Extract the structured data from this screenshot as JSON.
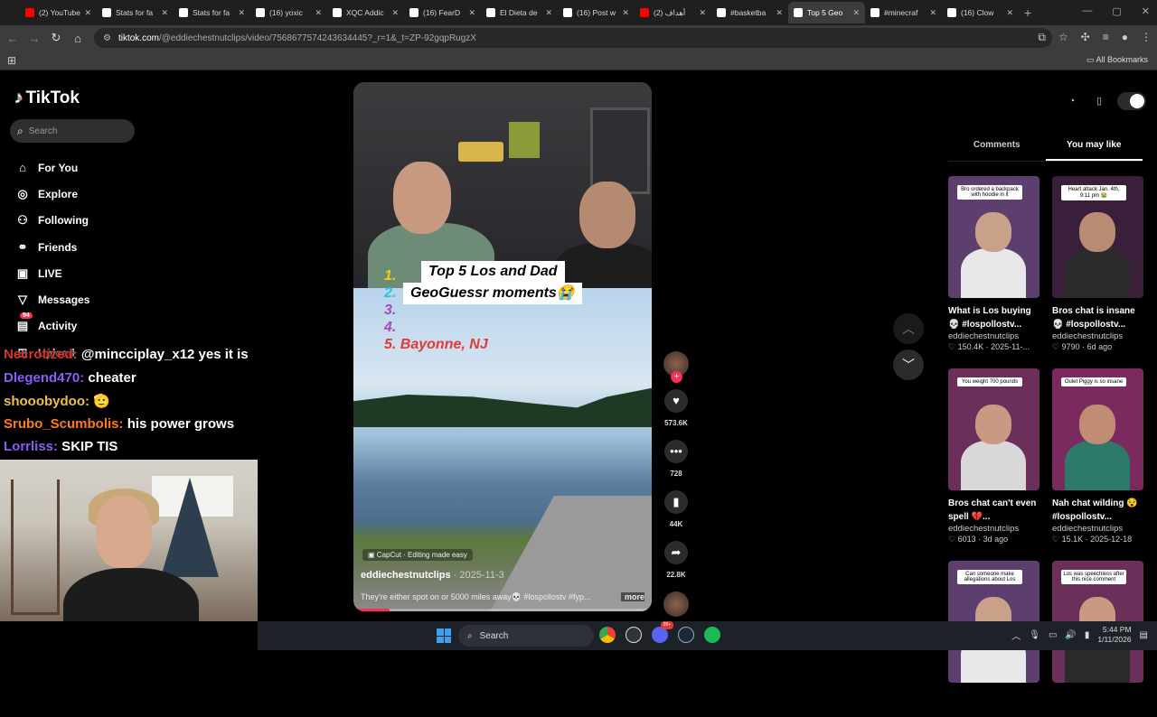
{
  "browser": {
    "tabs": [
      {
        "title": "(2) YouTube",
        "fav": "#ff0000",
        "active": false
      },
      {
        "title": "Stats for fa",
        "fav": "#ffffff",
        "active": false
      },
      {
        "title": "Stats for fa",
        "fav": "#ffffff",
        "active": false
      },
      {
        "title": "(16) yoxic",
        "fav": "#ffffff",
        "active": false
      },
      {
        "title": "XQC Addic",
        "fav": "#ffffff",
        "active": false
      },
      {
        "title": "(16) FearD",
        "fav": "#ffffff",
        "active": false
      },
      {
        "title": "El Dieta de",
        "fav": "#ffffff",
        "active": false
      },
      {
        "title": "(16) Post w",
        "fav": "#ffffff",
        "active": false
      },
      {
        "title": "(2) أهداف",
        "fav": "#ff0000",
        "active": false
      },
      {
        "title": "#basketba",
        "fav": "#ffffff",
        "active": false
      },
      {
        "title": "Top 5 Geo",
        "fav": "#ffffff",
        "active": true
      },
      {
        "title": "#minecraf",
        "fav": "#ffffff",
        "active": false
      },
      {
        "title": "(16) Clow",
        "fav": "#ffffff",
        "active": false
      }
    ],
    "url_host": "tiktok.com",
    "url_path": "/@eddiechestnutclips/video/7568677574243634445?_r=1&_t=ZP-92gqpRugzX",
    "all_bookmarks": "All Bookmarks"
  },
  "sidebar": {
    "logo": "TikTok",
    "search_placeholder": "Search",
    "items": [
      {
        "label": "For You",
        "icon": "home-icon",
        "glyph": "⌂"
      },
      {
        "label": "Explore",
        "icon": "compass-icon",
        "glyph": "◎"
      },
      {
        "label": "Following",
        "icon": "following-icon",
        "glyph": "⚇"
      },
      {
        "label": "Friends",
        "icon": "friends-icon",
        "glyph": "⚭"
      },
      {
        "label": "LIVE",
        "icon": "live-icon",
        "glyph": "▣"
      },
      {
        "label": "Messages",
        "icon": "messages-icon",
        "glyph": "▽"
      },
      {
        "label": "Activity",
        "icon": "activity-icon",
        "glyph": "▤",
        "badge": "94"
      },
      {
        "label": "Upload",
        "icon": "upload-icon",
        "glyph": "⊞"
      }
    ]
  },
  "chat": [
    {
      "user": "Necrotized:",
      "color": "#e0302a",
      "msg": " @mincciplay_x12 yes it is"
    },
    {
      "user": "Dlegend470:",
      "color": "#8a5cf6",
      "msg": " cheater"
    },
    {
      "user": "shooobydoo:",
      "color": "#f0c040",
      "msg": " 🫡"
    },
    {
      "user": "Srubo_Scumbolis:",
      "color": "#ff7a1a",
      "msg": " his power grows"
    },
    {
      "user": "Lorrliss:",
      "color": "#8a5cf6",
      "msg": " SKIP TIS"
    }
  ],
  "video": {
    "title_line1": "Top 5 Los and Dad",
    "title_line2": "GeoGuessr moments😭",
    "list": [
      {
        "n": "1.",
        "text": "",
        "color": "#f0d000"
      },
      {
        "n": "2.",
        "text": "",
        "color": "#26c6da"
      },
      {
        "n": "3.",
        "text": "",
        "color": "#ab47bc"
      },
      {
        "n": "4.",
        "text": "",
        "color": "#ab47bc"
      },
      {
        "n": "5.",
        "text": "Bayonne, NJ",
        "color": "#e53935"
      }
    ],
    "capcut": "CapCut · Editing made easy",
    "author": "eddiechestnutclips",
    "date": " · 2025-11-3",
    "caption": "They're either spot on or 5000 miles away💀 #lospollostv #fyp...",
    "more": "more",
    "progress": 0.12
  },
  "actions": [
    {
      "icon": "heart-icon",
      "glyph": "♥",
      "count": "573.6K"
    },
    {
      "icon": "comment-icon",
      "glyph": "•••",
      "count": "728"
    },
    {
      "icon": "bookmark-icon",
      "glyph": "▮",
      "count": "44K"
    },
    {
      "icon": "share-icon",
      "glyph": "➦",
      "count": "22.8K"
    }
  ],
  "right_panel": {
    "tabs": [
      "Comments",
      "You may like"
    ],
    "cards": [
      {
        "caption": "Bro ordered a backpack with hoodie in it",
        "title": "What is Los buying 💀 #lospollostv...",
        "author": "eddiechestnutclips",
        "stats": "♡ 150.4K · 2025-11-...",
        "bg": "#5c3f6e",
        "skin": "#c9a08a",
        "shirt": "#e8e8e8"
      },
      {
        "caption": "Heart attack Jan. 4th, 9:11 pm 😭",
        "title": "Bros chat is insane 💀 #lospollostv...",
        "author": "eddiechestnutclips",
        "stats": "♡ 9790 · 6d ago",
        "bg": "#3a1f3a",
        "skin": "#b88c74",
        "shirt": "#2a2a2a"
      },
      {
        "caption": "You weight 700 pounds",
        "title": "Bros chat can't even spell 💔...",
        "author": "eddiechestnutclips",
        "stats": "♡ 6013 · 3d ago",
        "bg": "#6b2f5a",
        "skin": "#c89a84",
        "shirt": "#d8d8d8"
      },
      {
        "caption": "Oulet Piggy is so insane",
        "title": "Nah chat wilding 😵 #lospollostv...",
        "author": "eddiechestnutclips",
        "stats": "♡ 15.1K · 2025-12-18",
        "bg": "#7a2a5e",
        "skin": "#c08c74",
        "shirt": "#2e7a6a"
      },
      {
        "caption": "Can someone make allegations about Los",
        "title": "",
        "author": "",
        "stats": "",
        "bg": "#5c3f6e",
        "skin": "#c9a08a",
        "shirt": "#e8e8e8"
      },
      {
        "caption": "Los was speechless after this nice comment",
        "title": "",
        "author": "",
        "stats": "",
        "bg": "#6b2f5a",
        "skin": "#c89a84",
        "shirt": "#2a2a2a"
      }
    ]
  },
  "taskbar": {
    "search": "Search",
    "time": "5:44 PM",
    "date": "1/11/2026",
    "notif_badge": "99+"
  }
}
